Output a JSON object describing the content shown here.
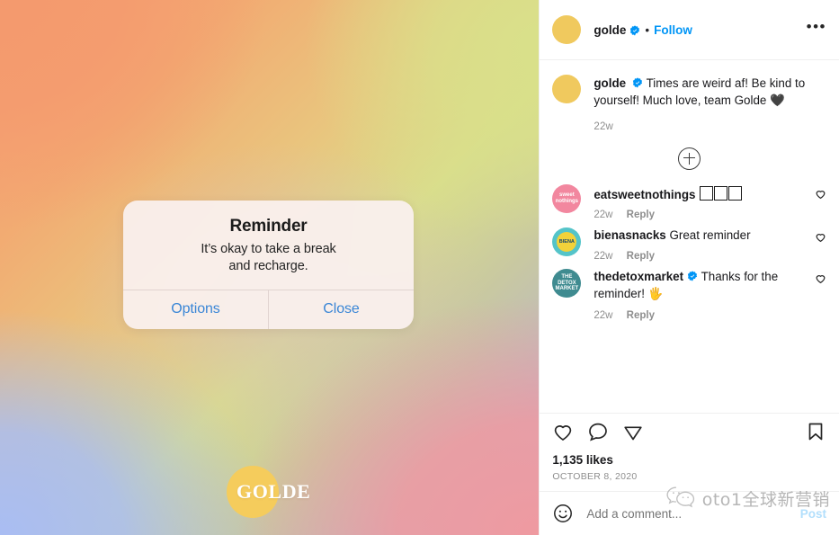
{
  "post": {
    "header": {
      "username": "golde",
      "verified": true,
      "separator": "•",
      "follow_label": "Follow",
      "more_label": "•••",
      "avatar_color": "#f0c95e"
    },
    "caption": {
      "username": "golde",
      "verified": true,
      "text": "Times are weird af! Be kind to yourself! Much love, team Golde",
      "emoji": "🖤",
      "timestamp": "22w"
    },
    "load_more": {
      "icon": "plus-circle-icon",
      "label": ""
    },
    "comments": [
      {
        "username": "eatsweetnothings",
        "verified": false,
        "text": "",
        "emoji_boxes": 3,
        "timestamp": "22w",
        "reply_label": "Reply",
        "avatar_color": "#f2879f",
        "avatar_text": "sweet nothings"
      },
      {
        "username": "bienasnacks",
        "verified": false,
        "text": "Great reminder",
        "emoji_boxes": 0,
        "timestamp": "22w",
        "reply_label": "Reply",
        "avatar_color": "#54c4c9",
        "avatar_text": "BIENA"
      },
      {
        "username": "thedetoxmarket",
        "verified": true,
        "text": "Thanks for the reminder!",
        "emoji": "🖐",
        "emoji_boxes": 0,
        "timestamp": "22w",
        "reply_label": "Reply",
        "avatar_color": "#3f8b90",
        "avatar_text": "THE DETOX MARKET"
      }
    ],
    "actions": {
      "like_icon": "heart-icon",
      "comment_icon": "speech-bubble-icon",
      "share_icon": "paper-plane-icon",
      "save_icon": "bookmark-icon",
      "likes_count": "1,135 likes",
      "date": "OCTOBER 8, 2020"
    },
    "add_comment": {
      "emoji_icon": "smiley-icon",
      "placeholder": "Add a comment...",
      "value": "",
      "post_label": "Post"
    }
  },
  "media": {
    "alert": {
      "title": "Reminder",
      "message_line1": "It’s okay to take a break",
      "message_line2": "and recharge.",
      "options_label": "Options",
      "close_label": "Close",
      "button_color": "#3a86d6"
    },
    "brand_logo": {
      "text": "GOLDE",
      "dot_color": "#f5cc5c"
    },
    "gradient_colors": {
      "top_left": "#f49a6e",
      "top_right": "#d9e08a",
      "bottom_left": "#a9bdf3",
      "bottom_right": "#ef9aa0"
    }
  },
  "watermark": {
    "text": "oto1全球新营销",
    "icon": "wechat-icon"
  }
}
